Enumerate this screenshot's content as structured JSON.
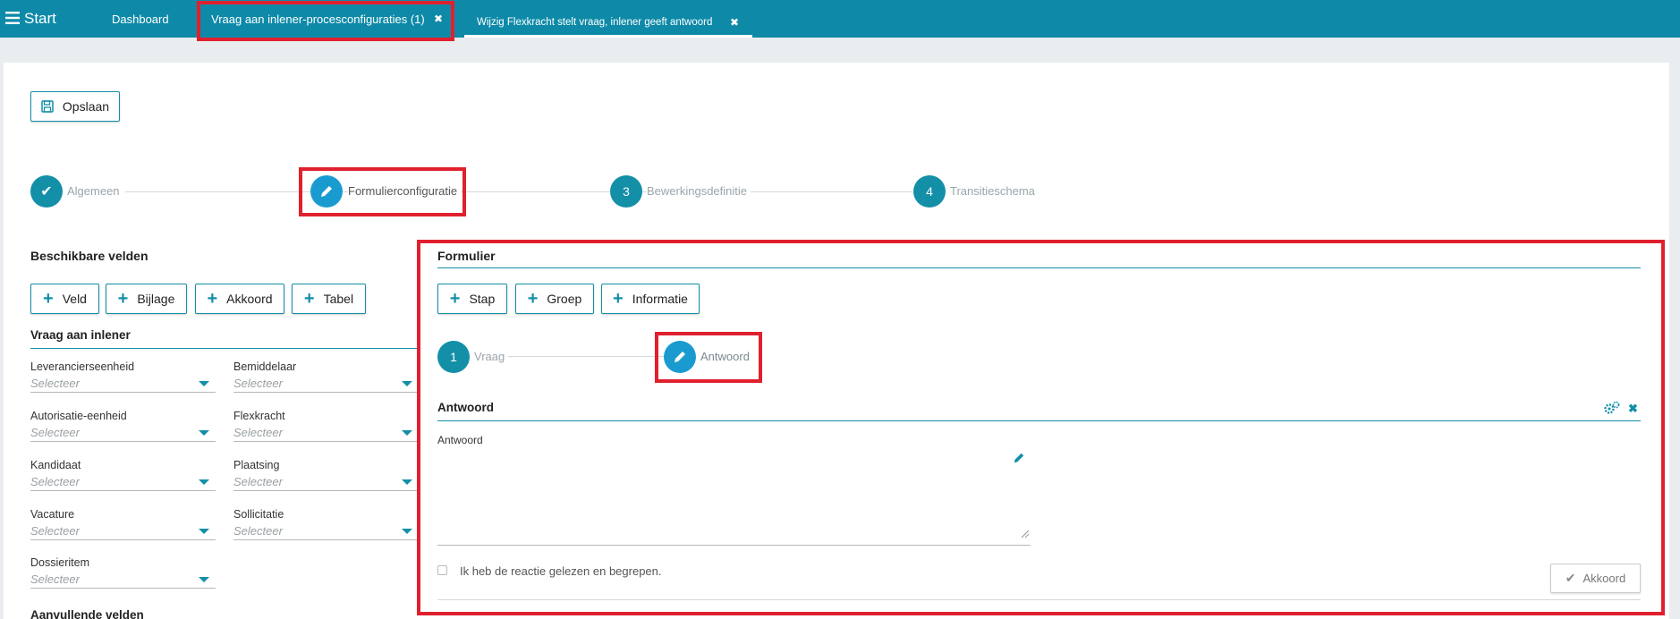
{
  "topbar": {
    "start_label": "Start",
    "tabs": [
      {
        "label": "Dashboard"
      },
      {
        "label": "Vraag aan inlener-procesconfiguraties (1)",
        "close": "✖"
      },
      {
        "label": "Wijzig Flexkracht stelt vraag, inlener geeft antwoord",
        "close": "✖"
      }
    ]
  },
  "toolbar": {
    "save_label": "Opslaan"
  },
  "wizard": {
    "steps": [
      {
        "label": "Algemeen",
        "marker": "✔",
        "state": "done"
      },
      {
        "label": "Formulierconfiguratie",
        "marker": "pencil",
        "state": "active"
      },
      {
        "label": "Bewerkingsdefinitie",
        "marker": "3",
        "state": "todo"
      },
      {
        "label": "Transitieschema",
        "marker": "4",
        "state": "todo"
      }
    ]
  },
  "available": {
    "title": "Beschikbare velden",
    "buttons": [
      "Veld",
      "Bijlage",
      "Akkoord",
      "Tabel"
    ],
    "group_title": "Vraag aan inlener",
    "fields": [
      {
        "label": "Leverancierseenheid",
        "placeholder": "Selecteer"
      },
      {
        "label": "Bemiddelaar",
        "placeholder": "Selecteer"
      },
      {
        "label": "Autorisatie-eenheid",
        "placeholder": "Selecteer"
      },
      {
        "label": "Flexkracht",
        "placeholder": "Selecteer"
      },
      {
        "label": "Kandidaat",
        "placeholder": "Selecteer"
      },
      {
        "label": "Plaatsing",
        "placeholder": "Selecteer"
      },
      {
        "label": "Vacature",
        "placeholder": "Selecteer"
      },
      {
        "label": "Sollicitatie",
        "placeholder": "Selecteer"
      },
      {
        "label": "Dossieritem",
        "placeholder": "Selecteer"
      }
    ],
    "extra_title": "Aanvullende velden"
  },
  "form": {
    "title": "Formulier",
    "buttons": [
      "Stap",
      "Groep",
      "Informatie"
    ],
    "steps": [
      {
        "label": "Vraag",
        "marker": "1"
      },
      {
        "label": "Antwoord",
        "marker": "pencil"
      }
    ],
    "section_title": "Antwoord",
    "field_label": "Antwoord",
    "checkbox_label": "Ik heb de reactie gelezen en begrepen.",
    "akkoord_label": "Akkoord"
  },
  "colors": {
    "accent": "#138fa8",
    "topbar": "#0e8aa8",
    "highlight": "#e0202e"
  }
}
